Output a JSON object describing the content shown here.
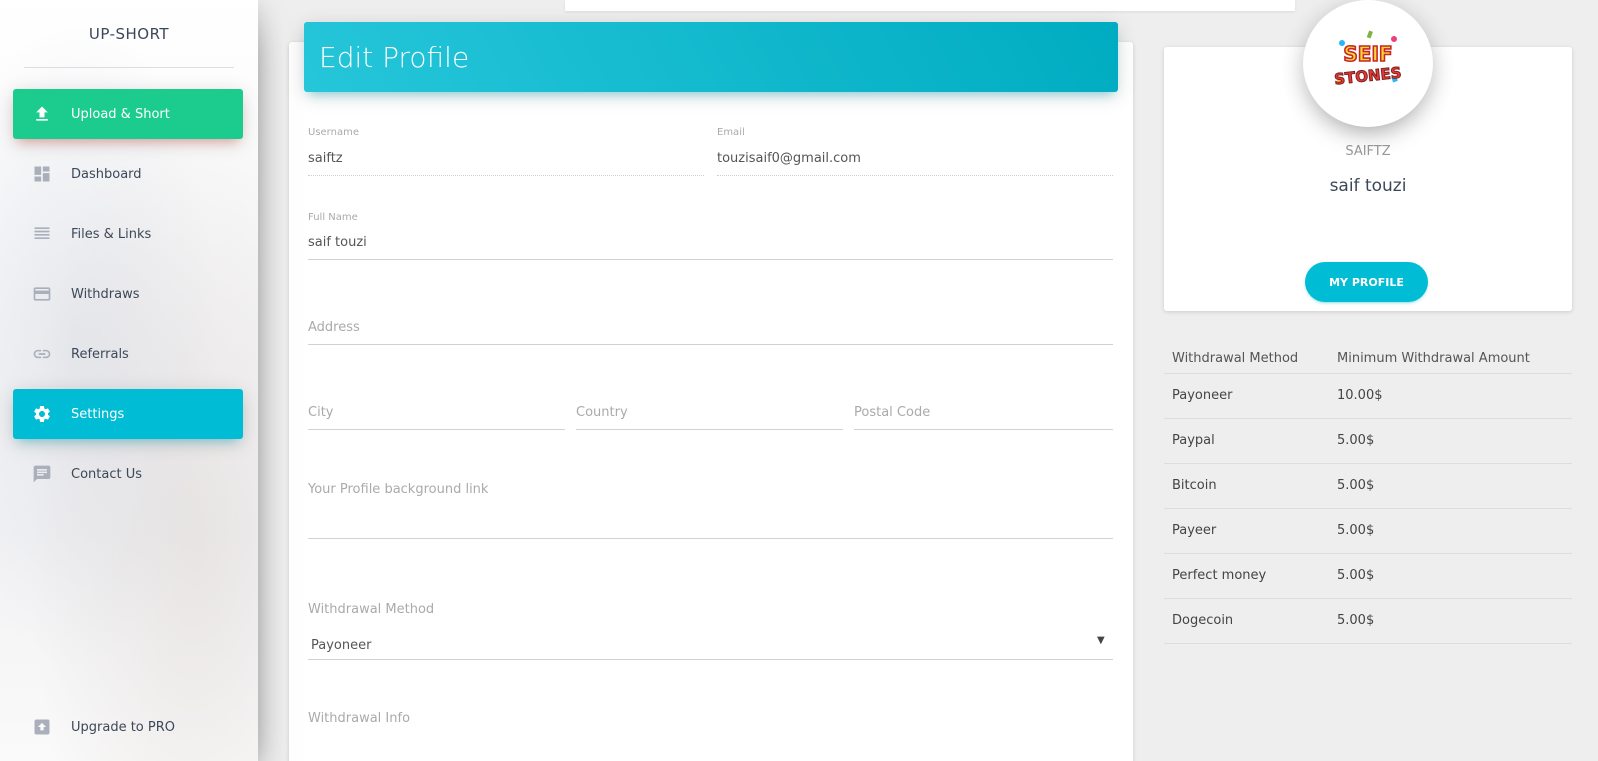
{
  "sidebar": {
    "brand": "UP-SHORT",
    "items": [
      {
        "label": "Upload & Short",
        "icon": "upload-icon"
      },
      {
        "label": "Dashboard",
        "icon": "dashboard-icon"
      },
      {
        "label": "Files & Links",
        "icon": "list-icon"
      },
      {
        "label": "Withdraws",
        "icon": "credit-card-icon"
      },
      {
        "label": "Referrals",
        "icon": "link-icon"
      },
      {
        "label": "Settings",
        "icon": "gear-icon"
      },
      {
        "label": "Contact Us",
        "icon": "chat-icon"
      }
    ],
    "upgrade": {
      "label": "Upgrade to PRO",
      "icon": "upgrade-icon"
    },
    "colors": {
      "upload": "#1bcc8e",
      "active": "#00bcd4"
    }
  },
  "form": {
    "title": "Edit Profile",
    "username": {
      "label": "Username",
      "value": "saiftz"
    },
    "email": {
      "label": "Email",
      "value": "touzisaif0@gmail.com"
    },
    "fullname": {
      "label": "Full Name",
      "value": "saif touzi"
    },
    "address": {
      "placeholder": "Address"
    },
    "city": {
      "placeholder": "City"
    },
    "country": {
      "placeholder": "Country"
    },
    "postal": {
      "placeholder": "Postal Code"
    },
    "background": {
      "placeholder": "Your Profile background link"
    },
    "withdrawal_method": {
      "label": "Withdrawal Method",
      "value": "Payoneer"
    },
    "withdrawal_info": {
      "label": "Withdrawal Info"
    }
  },
  "profile": {
    "logo_text": "SEIF STONES",
    "username": "SAIFTZ",
    "name": "saif touzi",
    "button": "MY PROFILE"
  },
  "withdraw_table": {
    "headers": [
      "Withdrawal Method",
      "Minimum Withdrawal Amount"
    ],
    "rows": [
      [
        "Payoneer",
        "10.00$"
      ],
      [
        "Paypal",
        "5.00$"
      ],
      [
        "Bitcoin",
        "5.00$"
      ],
      [
        "Payeer",
        "5.00$"
      ],
      [
        "Perfect money",
        "5.00$"
      ],
      [
        "Dogecoin",
        "5.00$"
      ]
    ]
  }
}
